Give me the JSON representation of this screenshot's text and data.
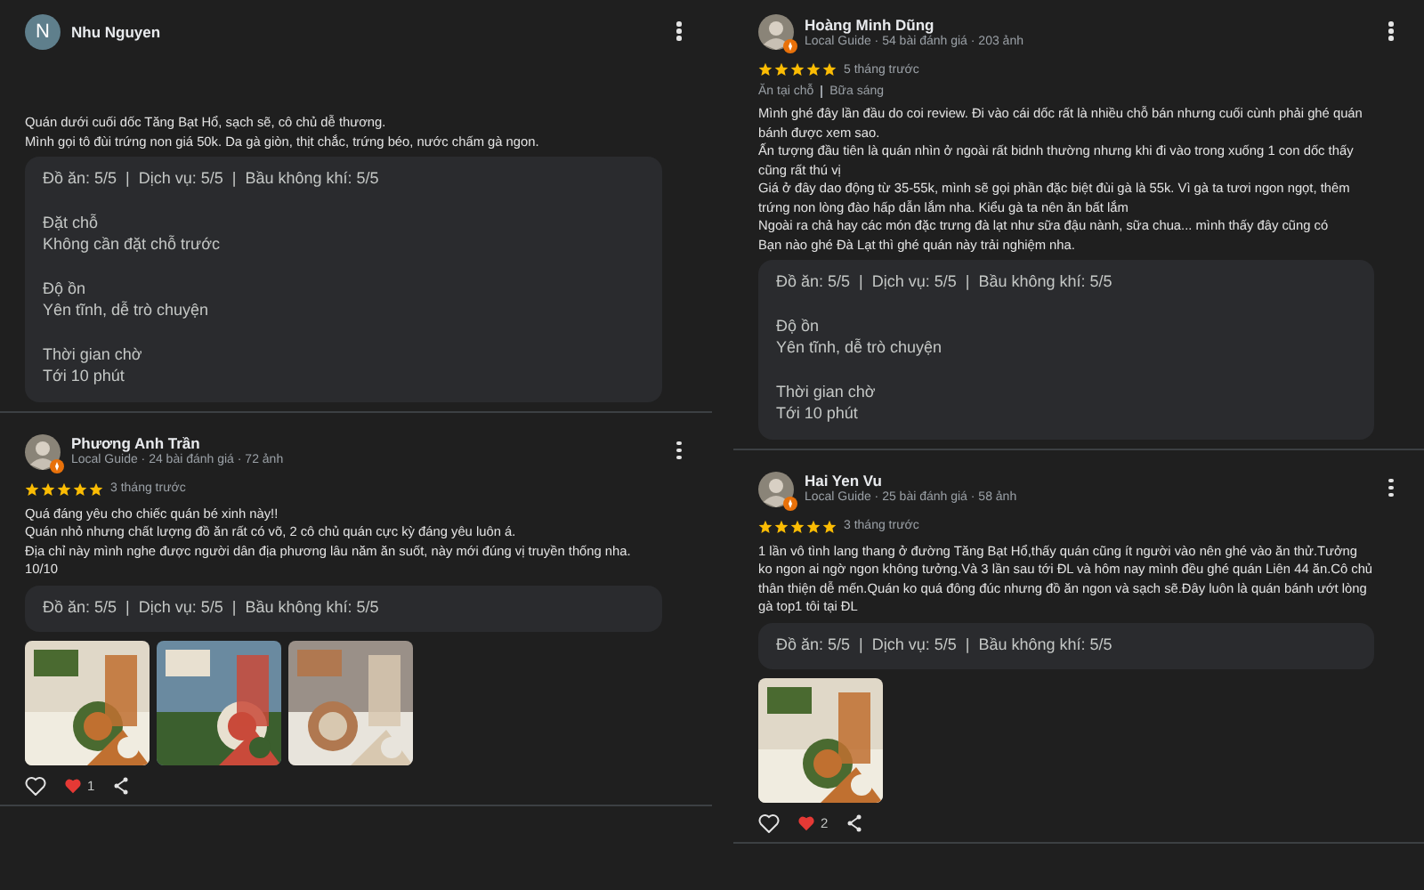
{
  "columns": [
    {
      "reviews": [
        {
          "name": "Nhu Nguyen",
          "avatar": {
            "kind": "letter",
            "letter": "N"
          },
          "text": "Quán dưới cuối dốc Tăng Bạt Hổ, sạch sẽ, cô chủ dễ thương.\nMình gọi tô đùi trứng non giá 50k. Da gà giòn, thịt chắc, trứng béo, nước chấm gà ngon.",
          "attributes": {
            "summary": "Đồ ăn: 5/5  |  Dịch vụ: 5/5  |  Bầu không khí: 5/5",
            "details": [
              {
                "label": "Đặt chỗ",
                "value": "Không cần đặt chỗ trước"
              },
              {
                "label": "Độ ồn",
                "value": "Yên tĩnh, dễ trò chuyện"
              },
              {
                "label": "Thời gian chờ",
                "value": "Tới 10 phút"
              }
            ]
          }
        },
        {
          "name": "Phương Anh Trần",
          "avatar": {
            "kind": "picture",
            "local_guide": true
          },
          "meta": "Local Guide · 24 bài đánh giá · 72 ảnh",
          "stars": 5,
          "time": "3 tháng trước",
          "text": "Quá đáng yêu cho chiếc quán bé xinh này!!\nQuán nhỏ nhưng chất lượng đồ ăn rất có võ, 2 cô chủ quán cực kỳ đáng yêu luôn á.\nĐịa chỉ này mình nghe được người dân địa phương lâu năm ăn suốt, này mới đúng vị truyền thống nha.\n10/10",
          "attributes": {
            "summary": "Đồ ăn: 5/5  |  Dịch vụ: 5/5  |  Bầu không khí: 5/5"
          },
          "photos": [
            {
              "kind": "picture"
            },
            {
              "kind": "picture"
            },
            {
              "kind": "picture"
            }
          ],
          "likes": "1"
        }
      ]
    },
    {
      "reviews": [
        {
          "name": "Hoàng Minh Dũng",
          "avatar": {
            "kind": "picture",
            "local_guide": true
          },
          "meta": "Local Guide · 54 bài đánh giá · 203 ảnh",
          "stars": 5,
          "time": "5 tháng trước",
          "tags": [
            "Ăn tại chỗ",
            "Bữa sáng"
          ],
          "text": "Mình ghé đây lần đầu do coi review. Đi vào cái dốc rất là nhiều chỗ bán nhưng cuối cùnh phải ghé quán bánh được xem sao.\nẤn tượng đầu tiên là quán nhìn ở ngoài rất bidnh thường nhưng khi đi vào trong xuống 1 con dốc thấy cũng rất thú vị\nGiá ở đây dao động từ 35-55k, mình sẽ gọi phần đặc biệt đùi gà là 55k. Vì gà ta tươi ngon ngọt, thêm trứng non lòng đào hấp dẫn lắm nha. Kiểu gà ta nên ăn bất lắm\nNgoài ra chả hay các món đặc trưng đà lạt như sữa đậu nành, sữa chua... mình thấy đây cũng có\nBạn nào ghé Đà Lạt thì ghé quán này trải nghiệm nha.",
          "attributes": {
            "summary": "Đồ ăn: 5/5  |  Dịch vụ: 5/5  |  Bầu không khí: 5/5",
            "details": [
              {
                "label": "Độ ồn",
                "value": "Yên tĩnh, dễ trò chuyện"
              },
              {
                "label": "Thời gian chờ",
                "value": "Tới 10 phút"
              }
            ]
          }
        },
        {
          "name": "Hai Yen Vu",
          "avatar": {
            "kind": "picture",
            "local_guide": true
          },
          "meta": "Local Guide · 25 bài đánh giá · 58 ảnh",
          "stars": 5,
          "time": "3 tháng trước",
          "text": "1 lần vô tình lang thang ở đường Tăng Bạt Hổ,thấy quán cũng ít người vào nên ghé vào ăn thử.Tưởng ko ngon ai ngờ ngon không tưởng.Và 3 lần sau tới ĐL và hôm nay mình đều ghé quán Liên 44 ăn.Cô chủ thân thiện dễ mến.Quán ko quá đông đúc nhưng đồ ăn ngon và sạch sẽ.Đây luôn là quán bánh ướt lòng gà top1 tôi tại ĐL",
          "attributes": {
            "summary": "Đồ ăn: 5/5  |  Dịch vụ: 5/5  |  Bầu không khí: 5/5"
          },
          "photos": [
            {
              "kind": "picture"
            }
          ],
          "likes": "2"
        }
      ]
    }
  ]
}
